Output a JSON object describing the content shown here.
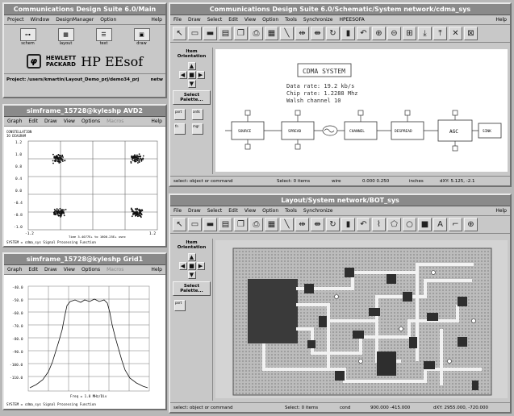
{
  "main": {
    "title": "Communications Design Suite 6.0/Main",
    "menu": [
      "Project",
      "Window",
      "DesignManager",
      "Option"
    ],
    "help": "Help",
    "icons": [
      "schem",
      "layout",
      "text",
      "draw"
    ],
    "logo_line1": "HEWLETT",
    "logo_line2": "PACKARD",
    "logo_brand": "HP EEsof",
    "project_label": "Project: /users/kmartin/Layout_Demo_prj/demo34_prj",
    "project_suffix": "netw"
  },
  "avd2": {
    "title": "simframe_15728@kyleshp AVD2",
    "menu": [
      "Graph",
      "Edit",
      "Draw",
      "View",
      "Options",
      "Macros"
    ],
    "help": "Help",
    "header_left": "CONSTELLATION",
    "header_right": "IO DIAGRAM",
    "yticks": [
      "1.2",
      "1.0",
      "0.8",
      "0.4",
      "0.0",
      "-0.4",
      "-0.8",
      "-1.0"
    ],
    "xticks": [
      "-1.2",
      "1.2"
    ],
    "time_note": "Time 3.4077E+ to 1600.25E+ usec",
    "footer": "SYSTEM = cdma_sys   Signal Processing Function"
  },
  "grid1": {
    "title": "simframe_15728@kyleshp Grid1",
    "menu": [
      "Graph",
      "Edit",
      "Draw",
      "View",
      "Options",
      "Macros"
    ],
    "help": "Help",
    "yticks": [
      "-40.0",
      "-50.0",
      "-60.0",
      "-70.0",
      "-80.0",
      "-90.0",
      "-100.0",
      "-110.0"
    ],
    "x_note": "Freq = 1.0 MHz/Div",
    "footer": "SYSTEM = cdma_sys   Signal Processing Function"
  },
  "schematic": {
    "title": "Communications Design Suite 6.0/Schematic/System network/cdma_sys",
    "menu": [
      "File",
      "Draw",
      "Select",
      "Edit",
      "View",
      "Option",
      "Tools",
      "Synchronize",
      "HPEESOFA"
    ],
    "help": "Help",
    "item_orientation": "Item Orientation",
    "select_palette": "Select Palette...",
    "palette_labels": [
      "port",
      "antk",
      "fn",
      "mgr"
    ],
    "cdma_title": "CDMA SYSTEM",
    "info_lines": [
      "Data rate: 19.2 kb/s",
      "Chip rate: 1.2288 Mhz",
      "Walsh channel 10"
    ],
    "block_labels": [
      "SOURCE",
      "SPREAD",
      "CHANNEL",
      "DESPREAD",
      "AGC",
      "SINK"
    ],
    "status": [
      "select: object or command",
      "Select: 0 items",
      "wire",
      "0.000  0.250",
      "inches",
      "dXY: 5.125, -2.1"
    ]
  },
  "layout": {
    "title": "Layout/System network/BOT_sys",
    "menu": [
      "File",
      "Draw",
      "Select",
      "Edit",
      "View",
      "Option",
      "Tools",
      "Synchronize"
    ],
    "help": "Help",
    "item_orientation": "Item Orientation",
    "select_palette": "Select Palette...",
    "palette_labels": [
      "port"
    ],
    "status": [
      "select: object or command",
      "Select: 0 items",
      "cond",
      "900.000  -415.000",
      "dXY: 2955.000, -720.000"
    ]
  }
}
